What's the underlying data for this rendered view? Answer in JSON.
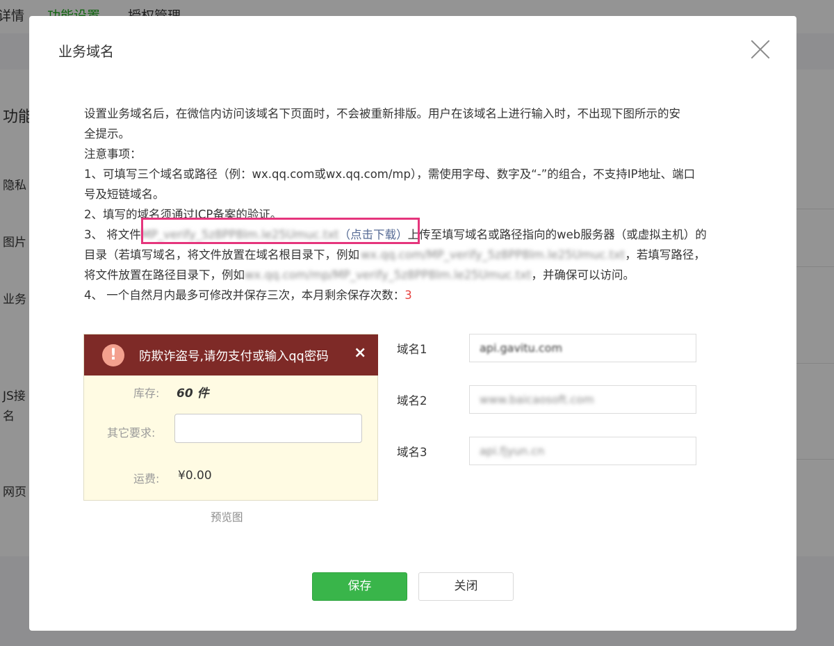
{
  "background": {
    "tabs": [
      "详情",
      "功能设置",
      "授权管理"
    ],
    "heading": "功能",
    "labels": [
      "隐私",
      "图片",
      "业务",
      "JS接",
      "名",
      "网页"
    ]
  },
  "dialog": {
    "title": "业务域名",
    "description": {
      "line1": "设置业务域名后，在微信内访问该域名下页面时，不会被重新排版。用户在该域名上进行输入时，不出现下图所示的安",
      "line2": "全提示。",
      "notes_title": "注意事项：",
      "note1_a": "1、可填写三个域名或路径（例：wx.qq.com或wx.qq.com/mp），需使用字母、数字及“-”的组合，不支持IP地址、端口",
      "note1_b": "号及短链域名。",
      "note2": "2、填写的域名须通过ICP备案的验证。",
      "note3_prefix": "3、 将文件",
      "note3_file": "MP_verify_5z8PP8Im.le25Umuc.txt",
      "note3_link": "（点击下载）",
      "note3_suffix": "上传至填写域名或路径指向的web服务器（或虚拟主机）的",
      "note3_b_prefix": "目录（若填写域名，将文件放置在域名根目录下，例如",
      "note3_b_example": "wx.qq.com/MP_verify_5z8PP8Im.le25Umuc.txt",
      "note3_b_suffix": "，若填写路径，",
      "note3_c_prefix": "将文件放置在路径目录下，例如",
      "note3_c_example": "wx.qq.com/mp/MP_verify_5z8PP8Im.le25Umuc.txt",
      "note3_c_suffix": "，并确保可以访问。",
      "note4_prefix": "4、 一个自然月内最多可修改并保存三次，本月剩余保存次数：",
      "note4_count": "3"
    },
    "preview": {
      "warning_text": "防欺诈盗号,请勿支付或输入qq密码",
      "warning_close": "×",
      "stock_label": "库存:",
      "stock_value": "60 件",
      "other_label": "其它要求:",
      "shipping_label": "运费:",
      "shipping_value": "¥0.00",
      "caption": "预览图"
    },
    "domains": [
      {
        "label": "域名1",
        "value": "api.gavitu.com"
      },
      {
        "label": "域名2",
        "value": "www.baicaosoft.com"
      },
      {
        "label": "域名3",
        "value": "api.fjyun.cn"
      }
    ],
    "buttons": {
      "save": "保存",
      "close": "关闭"
    },
    "colors": {
      "primary": "#39b54a",
      "link": "#576b95",
      "warning_bar": "#7e2a27",
      "highlight": "#e5357c",
      "count": "#e64340"
    }
  }
}
